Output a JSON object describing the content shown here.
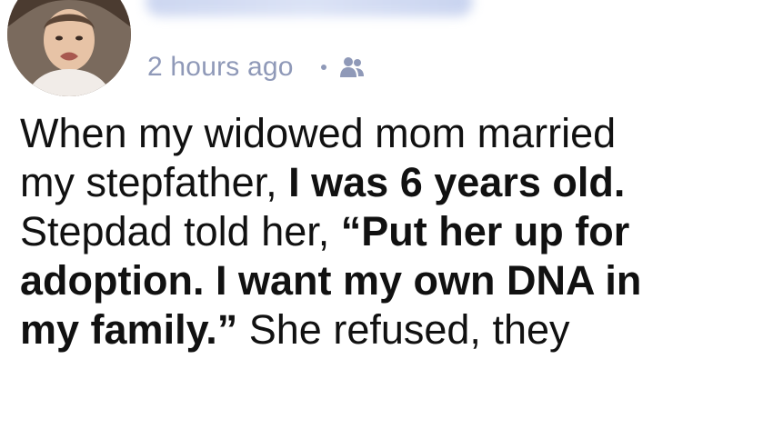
{
  "post": {
    "author": {
      "avatar_icon": "profile-avatar"
    },
    "timestamp": "2 hours ago",
    "separator": "•",
    "audience_icon": "friends-icon",
    "body": {
      "line1": "When my widowed mom married",
      "line2_normal": "my stepfather, ",
      "line2_bold": "I was 6 years old.",
      "line3_normal": "Stepdad told her, ",
      "line3_bold": "“Put her up for",
      "line4_bold": "adoption. I want my own DNA in",
      "line5_bold": "my family.”",
      "line5_normal": " She refused, they"
    }
  },
  "colors": {
    "meta_text": "#8f99b8",
    "body_text": "#111111",
    "background": "#ffffff"
  }
}
